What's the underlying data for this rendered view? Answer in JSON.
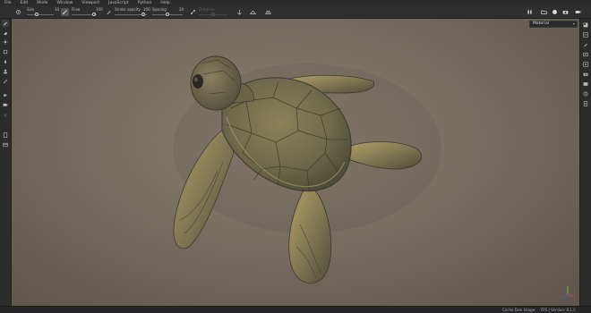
{
  "menu": [
    "File",
    "Edit",
    "Mode",
    "Window",
    "Viewport",
    "JavaScript",
    "Python",
    "Help"
  ],
  "toolbar": {
    "size": {
      "label": "Size",
      "value": "10",
      "level": 0.35
    },
    "flow": {
      "label": "Flow",
      "value": "100",
      "level": 0.9
    },
    "stroke_opacity": {
      "label": "Stroke opacity",
      "value": "100",
      "level": 0.9
    },
    "spacing": {
      "label": "Spacing",
      "value": "20",
      "level": 0.5
    },
    "distance": {
      "label": "Distance",
      "value": "",
      "level": 0.5
    }
  },
  "viewport": {
    "channel": "Material"
  },
  "status": {
    "cache": "Cache Disk Usage:",
    "fps_version": "FPS | Version: 8.1.0"
  },
  "colors": {
    "accent": "#e0b040",
    "turtle_body": "#6f6a4c",
    "turtle_highlight": "#b8a266"
  },
  "icons": {
    "left": [
      "paint-brush-icon",
      "eraser-icon",
      "projection-icon",
      "geometry-decal-icon",
      "smudge-icon",
      "clone-icon",
      "color-picker-icon",
      "fill-icon",
      "bake-icon",
      "layer-icon",
      "settings-icon"
    ],
    "right": [
      "texture-set-list-icon",
      "layers-icon",
      "properties-icon",
      "shelf-icon",
      "display-settings-icon",
      "camera-icon",
      "render-icon",
      "history-icon",
      "log-icon"
    ]
  }
}
